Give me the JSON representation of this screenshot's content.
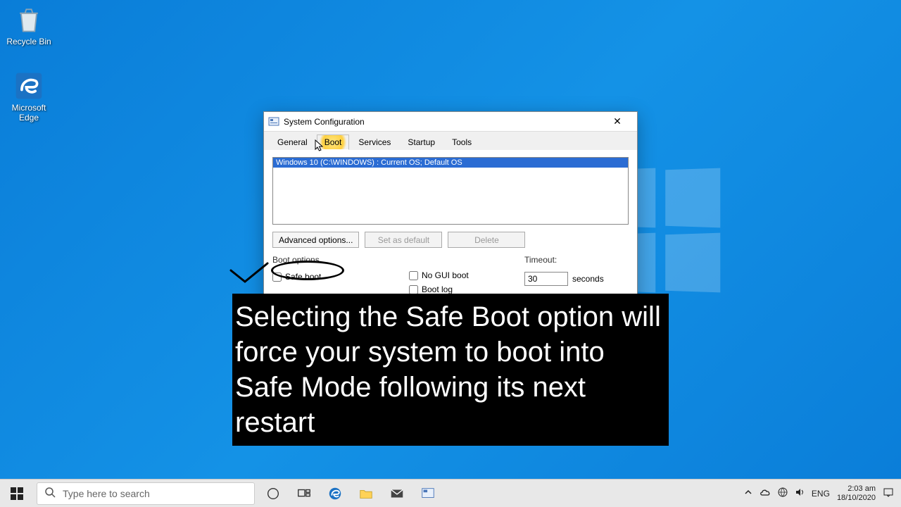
{
  "desktop": {
    "recycle_label": "Recycle Bin",
    "edge_label": "Microsoft Edge"
  },
  "dialog": {
    "title": "System Configuration",
    "tabs": {
      "general": "General",
      "boot": "Boot",
      "services": "Services",
      "startup": "Startup",
      "tools": "Tools"
    },
    "os_entry": "Windows 10 (C:\\WINDOWS) : Current OS; Default OS",
    "buttons": {
      "advanced": "Advanced options...",
      "set_default": "Set as default",
      "delete": "Delete"
    },
    "boot_options_label": "Boot options",
    "safe_boot_label": "Safe boot",
    "no_gui_label": "No GUI boot",
    "boot_log_label": "Boot log",
    "timeout_label": "Timeout:",
    "timeout_value": "30",
    "timeout_unit": "seconds"
  },
  "caption": "Selecting the Safe Boot option will force your system to boot into Safe Mode following its next restart",
  "taskbar": {
    "search_placeholder": "Type here to search",
    "lang": "ENG",
    "time": "2:03 am",
    "date": "18/10/2020"
  }
}
